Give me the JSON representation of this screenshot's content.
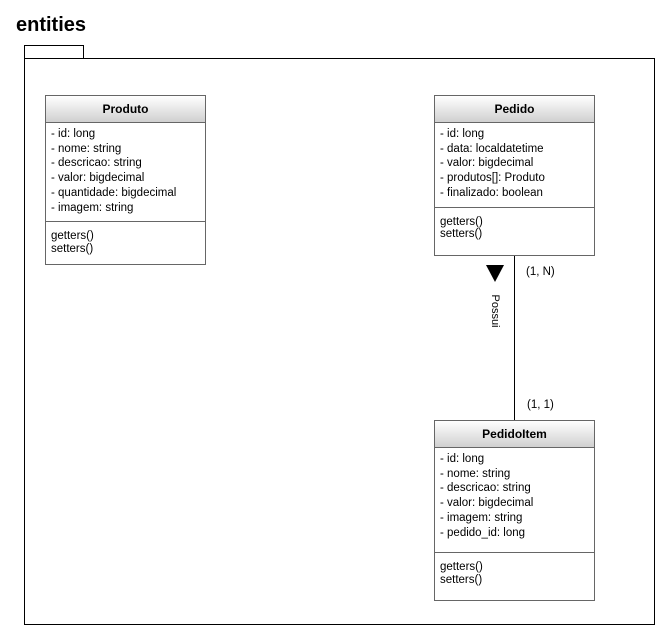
{
  "package": {
    "title": "entities"
  },
  "classes": {
    "produto": {
      "name": "Produto",
      "attributes": [
        "- id: long",
        "- nome: string",
        "- descricao: string",
        "- valor: bigdecimal",
        "- quantidade: bigdecimal",
        "- imagem: string"
      ],
      "methods": [
        "getters()",
        "setters()"
      ]
    },
    "pedido": {
      "name": "Pedido",
      "attributes": [
        "- id: long",
        "- data: localdatetime",
        "- valor: bigdecimal",
        "- produtos[]: Produto",
        "- finalizado: boolean"
      ],
      "methods": [
        "getters()",
        "setters()"
      ]
    },
    "pedidoitem": {
      "name": "PedidoItem",
      "attributes": [
        "- id: long",
        "- nome: string",
        "- descricao: string",
        "- valor: bigdecimal",
        "- imagem: string",
        "- pedido_id: long"
      ],
      "methods": [
        "getters()",
        "setters()"
      ]
    }
  },
  "relation": {
    "label": "Possui",
    "multiplicity_top": "(1, N)",
    "multiplicity_bottom": "(1, 1)"
  }
}
